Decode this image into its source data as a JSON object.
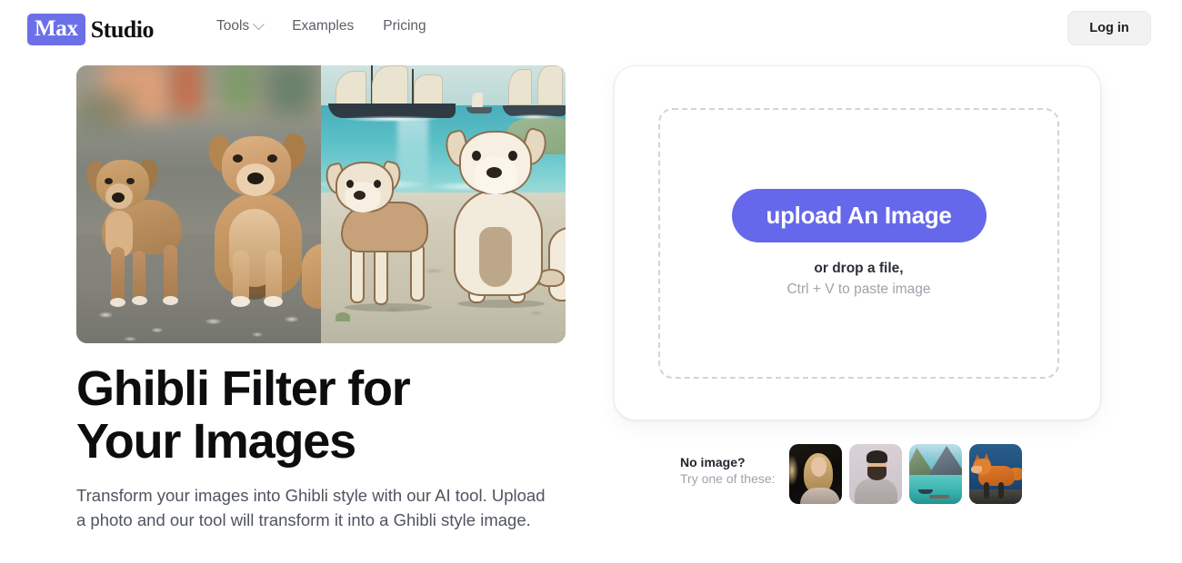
{
  "header": {
    "logo": {
      "badge_text": "Max",
      "word_text": "Studio",
      "badge_color": "#6c70e8"
    },
    "nav": [
      {
        "label": "Tools",
        "has_dropdown": true
      },
      {
        "label": "Examples",
        "has_dropdown": false
      },
      {
        "label": "Pricing",
        "has_dropdown": false
      }
    ],
    "login_label": "Log in"
  },
  "hero": {
    "image_alt": "Before and after comparison: two puppies photo transformed into Ghibli anime style beach scene",
    "before_label": "photo of two puppies on gravel road",
    "after_label": "Ghibli style illustration of two dogs on a beach with sailing ships",
    "title": "Ghibli Filter for Your Images",
    "subtitle": "Transform your images into Ghibli style with our AI tool. Upload a photo and our tool will transform it into a Ghibli style image."
  },
  "upload": {
    "button_label": "upload An Image",
    "drop_text": "or drop a file,",
    "paste_text": "Ctrl + V to paste image",
    "button_color": "#6568ea"
  },
  "samples": {
    "title": "No image?",
    "subtitle": "Try one of these:",
    "thumbnails": [
      {
        "name": "blonde-woman-portrait"
      },
      {
        "name": "bearded-man-portrait"
      },
      {
        "name": "turquoise-mountain-lake"
      },
      {
        "name": "red-fox"
      }
    ]
  }
}
